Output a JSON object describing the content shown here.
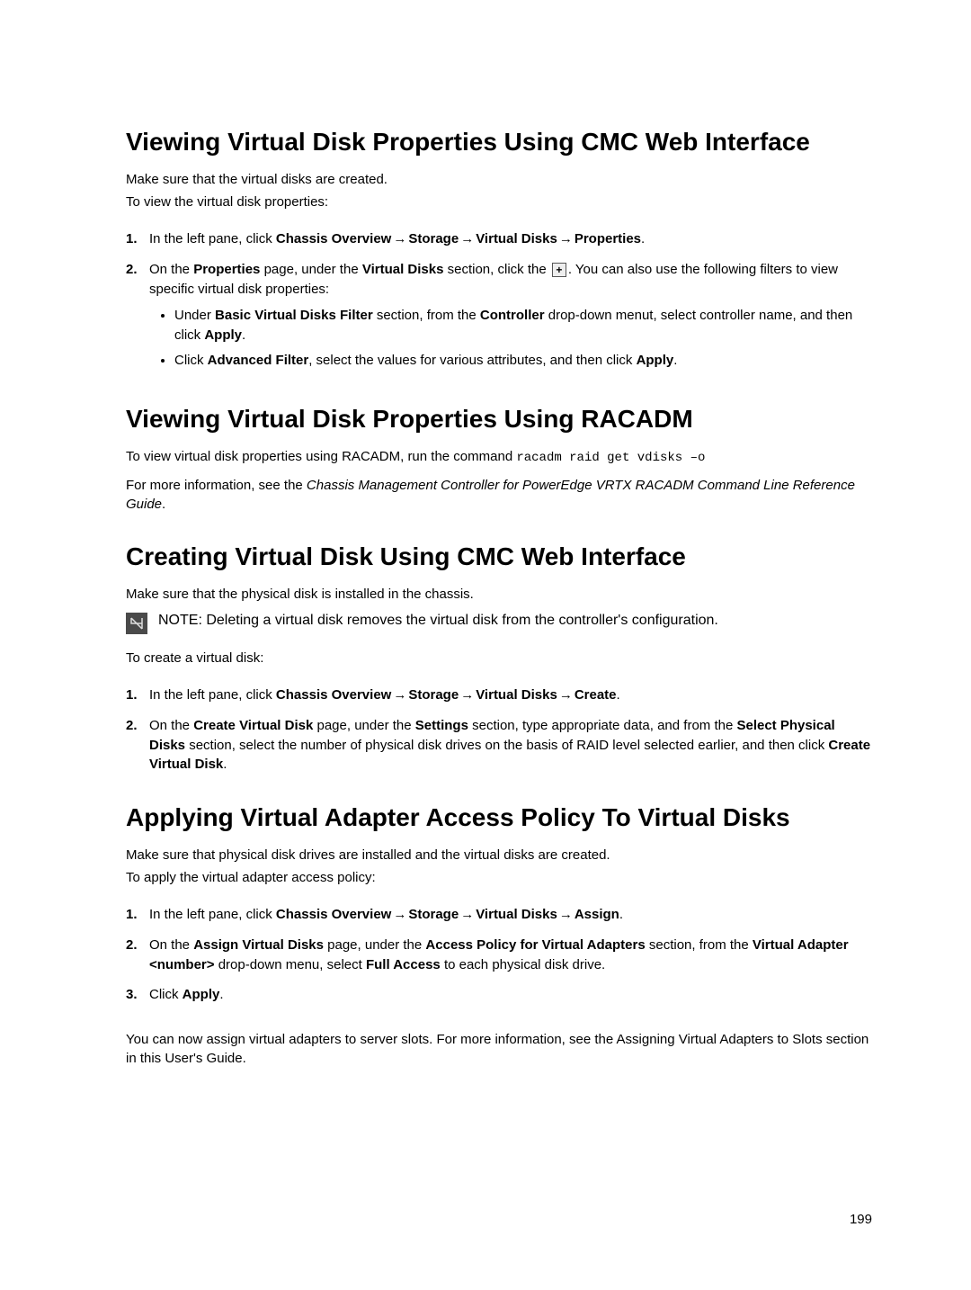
{
  "arrow": "→",
  "s1": {
    "h": "Viewing Virtual Disk Properties Using CMC Web Interface",
    "intro1": "Make sure that the virtual disks are created.",
    "intro2": "To view the virtual disk properties:",
    "step1_num": "1.",
    "step1_pre": "In the left pane, click ",
    "step1_b1": "Chassis Overview",
    "step1_b2": "Storage",
    "step1_b3": "Virtual Disks",
    "step1_b4": "Properties",
    "step1_end": ".",
    "step2_num": "2.",
    "step2_pre": "On the ",
    "step2_b1": "Properties",
    "step2_mid1": " page, under the ",
    "step2_b2": "Virtual Disks",
    "step2_mid2": " section, click the ",
    "step2_post": ". You can also use the following filters to view specific virtual disk properties:",
    "step2_ul1_pre": "Under ",
    "step2_ul1_b1": "Basic Virtual Disks Filter",
    "step2_ul1_mid": " section, from the ",
    "step2_ul1_b2": "Controller",
    "step2_ul1_mid2": " drop-down menut, select controller name, and then click ",
    "step2_ul1_b3": "Apply",
    "step2_ul1_end": ".",
    "step2_ul2_pre": "Click ",
    "step2_ul2_b1": "Advanced Filter",
    "step2_ul2_mid": ", select the values for various attributes, and then click ",
    "step2_ul2_b2": "Apply",
    "step2_ul2_end": "."
  },
  "s2": {
    "h": "Viewing Virtual Disk Properties Using RACADM",
    "p1_pre": "To view virtual disk properties using RACADM, run the command ",
    "p1_code": "racadm raid get vdisks –o",
    "p2_pre": "For more information, see the ",
    "p2_em": "Chassis Management Controller for PowerEdge VRTX RACADM Command Line Reference Guide",
    "p2_end": "."
  },
  "s3": {
    "h": "Creating Virtual Disk Using CMC Web Interface",
    "intro": "Make sure that the physical disk is installed in the chassis.",
    "note_label": "NOTE: ",
    "note_text": "Deleting a virtual disk removes the virtual disk from the controller's configuration.",
    "intro2": "To create a virtual disk:",
    "step1_num": "1.",
    "step1_pre": "In the left pane, click ",
    "step1_b1": "Chassis Overview",
    "step1_b2": "Storage",
    "step1_b3": "Virtual Disks",
    "step1_b4": "Create",
    "step1_end": ".",
    "step2_num": "2.",
    "step2_pre": "On the ",
    "step2_b1": "Create Virtual Disk",
    "step2_mid1": " page, under the ",
    "step2_b2": "Settings",
    "step2_mid2": " section, type appropriate data, and from the ",
    "step2_b3": "Select Physical Disks",
    "step2_mid3": " section, select the number of physical disk drives on the basis of RAID level selected earlier, and then click ",
    "step2_b4": "Create Virtual Disk",
    "step2_end": "."
  },
  "s4": {
    "h": "Applying Virtual Adapter Access Policy To Virtual Disks",
    "intro1": "Make sure that physical disk drives are installed and the virtual disks are created.",
    "intro2": "To apply the virtual adapter access policy:",
    "step1_num": "1.",
    "step1_pre": "In the left pane, click ",
    "step1_b1": "Chassis Overview",
    "step1_b2": "Storage",
    "step1_b3": "Virtual Disks",
    "step1_b4": "Assign",
    "step1_end": ".",
    "step2_num": "2.",
    "step2_pre": "On the ",
    "step2_b1": "Assign Virtual Disks",
    "step2_mid1": " page, under the ",
    "step2_b2": "Access Policy for Virtual Adapters",
    "step2_mid2": " section, from the ",
    "step2_b3": "Virtual Adapter <number>",
    "step2_mid3": " drop-down menu, select ",
    "step2_b4": "Full Access",
    "step2_mid4": " to each physical disk drive.",
    "step3_num": "3.",
    "step3_pre": "Click ",
    "step3_b1": "Apply",
    "step3_end": ".",
    "outro": "You can now assign virtual adapters to server slots. For more information, see the Assigning Virtual Adapters to Slots section in this User's Guide."
  },
  "page_number": "199"
}
